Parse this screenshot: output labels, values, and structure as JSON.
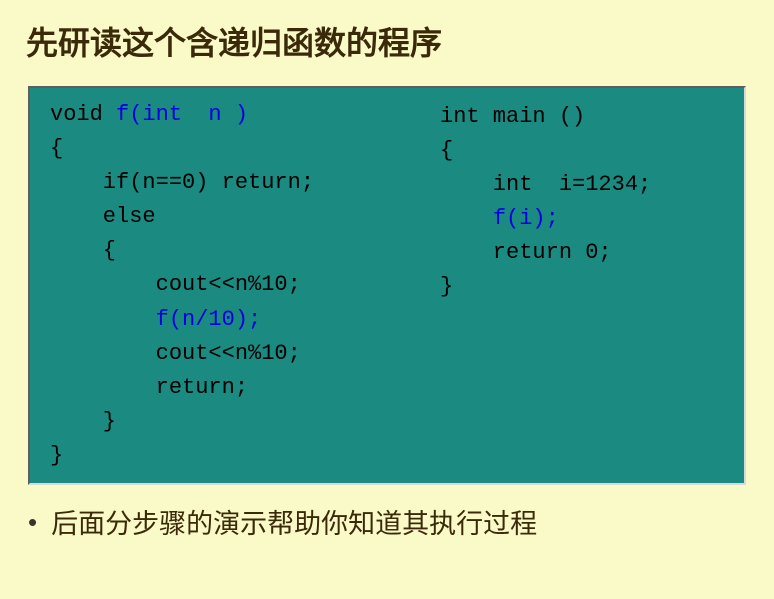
{
  "title": "先研读这个含递归函数的程序",
  "code": {
    "left": {
      "l1a": "void ",
      "l1b": "f(int  n )",
      "l2": "{",
      "l3": "    if(n==0) return;",
      "l4": "    else",
      "l5": "    {",
      "l6": "        cout<<n%10;",
      "l7a": "        ",
      "l7b": "f(n/10);",
      "l8": "        cout<<n%10;",
      "l9": "        return;",
      "l10": "    }",
      "l11": "}"
    },
    "right": {
      "r1": "int main ()",
      "r2": "{",
      "r3": "    int  i=1234;",
      "r4a": "    ",
      "r4b": "f(i);",
      "r5": "    return 0;",
      "r6": "}"
    }
  },
  "bullet": {
    "marker": "•",
    "text": "后面分步骤的演示帮助你知道其执行过程"
  }
}
